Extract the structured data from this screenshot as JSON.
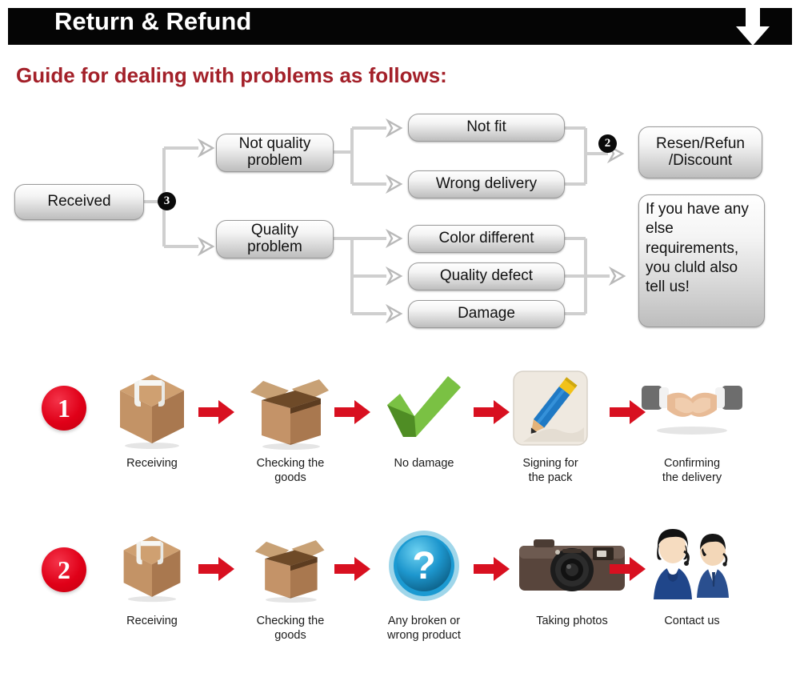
{
  "header": {
    "title": "Return & Refund",
    "arrow_icon": "down-arrow-icon",
    "bar_color": "#050505"
  },
  "subtitle": {
    "text": "Guide for dealing with problems as follows:",
    "color": "#a32029"
  },
  "flowchart": {
    "markers": {
      "received_branch": "3",
      "resolution_branch": "2"
    },
    "boxes": {
      "received": "Received",
      "not_quality_problem": "Not quality\nproblem",
      "quality_problem": "Quality\nproblem",
      "not_fit": "Not fit",
      "wrong_delivery": "Wrong delivery",
      "color_different": "Color different",
      "quality_defect": "Quality defect",
      "damage": "Damage",
      "resend_refund_discount": "Resen/Refun\n/Discount",
      "other_requirements": "If you have any else requirements, you cluld also tell us!"
    }
  },
  "steps": [
    {
      "number": "1",
      "items": [
        {
          "icon": "sealed-box-icon",
          "caption": "Receiving"
        },
        {
          "icon": "open-box-icon",
          "caption": "Checking the\ngoods"
        },
        {
          "icon": "green-check-icon",
          "caption": "No damage"
        },
        {
          "icon": "pencil-signing-icon",
          "caption": "Signing for\nthe pack"
        },
        {
          "icon": "handshake-icon",
          "caption": "Confirming\nthe delivery"
        }
      ],
      "arrow_icon": "red-right-arrow-icon"
    },
    {
      "number": "2",
      "items": [
        {
          "icon": "sealed-box-icon",
          "caption": "Receiving"
        },
        {
          "icon": "open-box-icon",
          "caption": "Checking the\ngoods"
        },
        {
          "icon": "blue-question-icon",
          "caption": "Any broken or\nwrong product"
        },
        {
          "icon": "camera-icon",
          "caption": "Taking photos"
        },
        {
          "icon": "support-agents-icon",
          "caption": "Contact us"
        }
      ],
      "arrow_icon": "red-right-arrow-icon"
    }
  ],
  "colors": {
    "red_accent": "#e00018",
    "red_arrow": "#d81020",
    "title_red": "#a32029",
    "box_border": "#9a9a9a",
    "connector": "#c9c9c9"
  }
}
